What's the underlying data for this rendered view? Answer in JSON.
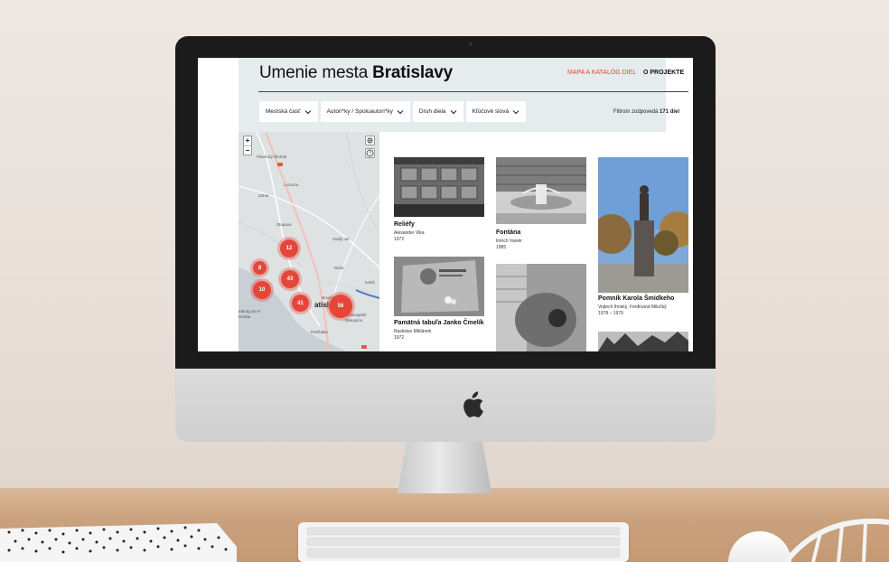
{
  "site": {
    "title_regular": "Umenie mesta ",
    "title_bold": "Bratislavy",
    "nav": [
      {
        "label": "MAPA A KATALÓG DIEL",
        "color": "#e0452e"
      },
      {
        "label": "O PROJEKTE",
        "color": "#111111"
      }
    ]
  },
  "filters": [
    {
      "label": "Mestská časť",
      "icon": "chevron-down-icon"
    },
    {
      "label": "Autori*ky / Spoluautori*ky",
      "icon": "chevron-down-icon"
    },
    {
      "label": "Druh diela",
      "icon": "chevron-down-icon"
    },
    {
      "label": "Kľúčové slová",
      "icon": "chevron-down-icon"
    }
  ],
  "results": {
    "prefix": "Filtrom zodpovedá ",
    "count": "171 diel"
  },
  "map": {
    "zoom_in": "+",
    "zoom_out": "−",
    "locate_icon": "crosshair-icon",
    "help_icon": "question-icon",
    "places": [
      "Plavecký Štvrtok",
      "Lozorno",
      "Zohor",
      "Stupava",
      "Svätý Jur",
      "Rača",
      "Nové M",
      "Ivank",
      "Petržalka",
      "Podunajské Biskupice",
      "mburg an er Donau",
      "atisla"
    ],
    "clusters": [
      "12",
      "8",
      "43",
      "10",
      "41",
      "56"
    ],
    "cluster_color": "#e6463a"
  },
  "artworks": [
    {
      "title": "Reliéfy",
      "author": "Alexander Vika",
      "year": "1972"
    },
    {
      "title": "Fontána",
      "author": "Imrich Vanek",
      "year": "1985"
    },
    {
      "title": "Pomník Karola Šmidkeho",
      "author": "Vojtech Ihriský, Ferdinand Milučký",
      "year": "1978 – 1979"
    },
    {
      "title": "Pamätná tabuľa Janko Čmelík",
      "author": "Rastislav Miklánek",
      "year": "1972"
    },
    {
      "title": "",
      "author": "",
      "year": ""
    },
    {
      "title": "",
      "author": "",
      "year": ""
    }
  ]
}
